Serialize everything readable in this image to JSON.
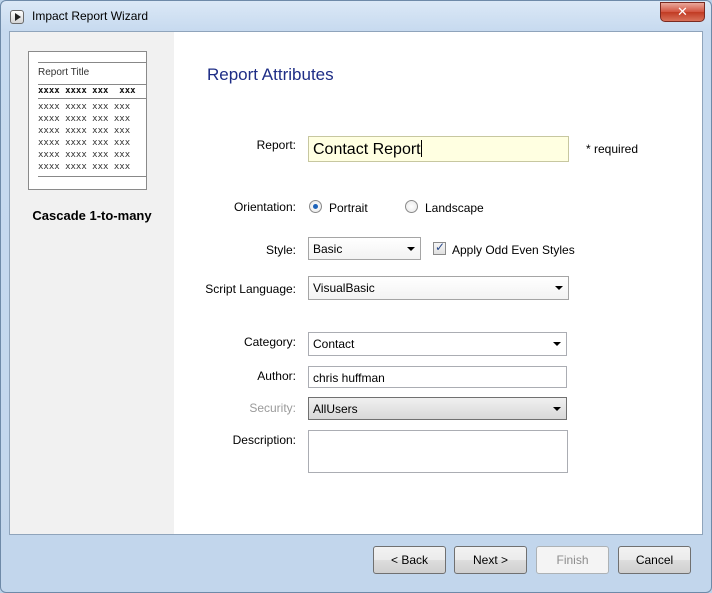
{
  "window": {
    "title": "Impact Report Wizard"
  },
  "left_panel": {
    "preview_title": "Report Title",
    "preview_header": "xxxx xxxx xxx  xxx",
    "preview_rows": [
      "xxxx xxxx xxx xxx",
      "xxxx xxxx xxx xxx",
      "xxxx xxxx xxx xxx",
      "xxxx xxxx xxx xxx",
      "xxxx xxxx xxx xxx",
      "xxxx xxxx xxx xxx"
    ],
    "layout_name": "Cascade 1-to-many"
  },
  "form": {
    "heading": "Report Attributes",
    "report_label": "Report:",
    "report_value": "Contact Report",
    "required_note": "* required",
    "orientation_label": "Orientation:",
    "orientation_options": [
      "Portrait",
      "Landscape"
    ],
    "orientation_selected": "Portrait",
    "style_label": "Style:",
    "style_value": "Basic",
    "odd_even_label": "Apply Odd Even Styles",
    "odd_even_checked": true,
    "script_label": "Script Language:",
    "script_value": "VisualBasic",
    "category_label": "Category:",
    "category_value": "Contact",
    "author_label": "Author:",
    "author_value": "chris huffman",
    "security_label": "Security:",
    "security_value": "AllUsers",
    "description_label": "Description:",
    "description_value": ""
  },
  "buttons": {
    "back": "< Back",
    "next": "Next >",
    "finish": "Finish",
    "cancel": "Cancel"
  },
  "icons": {
    "close": "✕"
  }
}
